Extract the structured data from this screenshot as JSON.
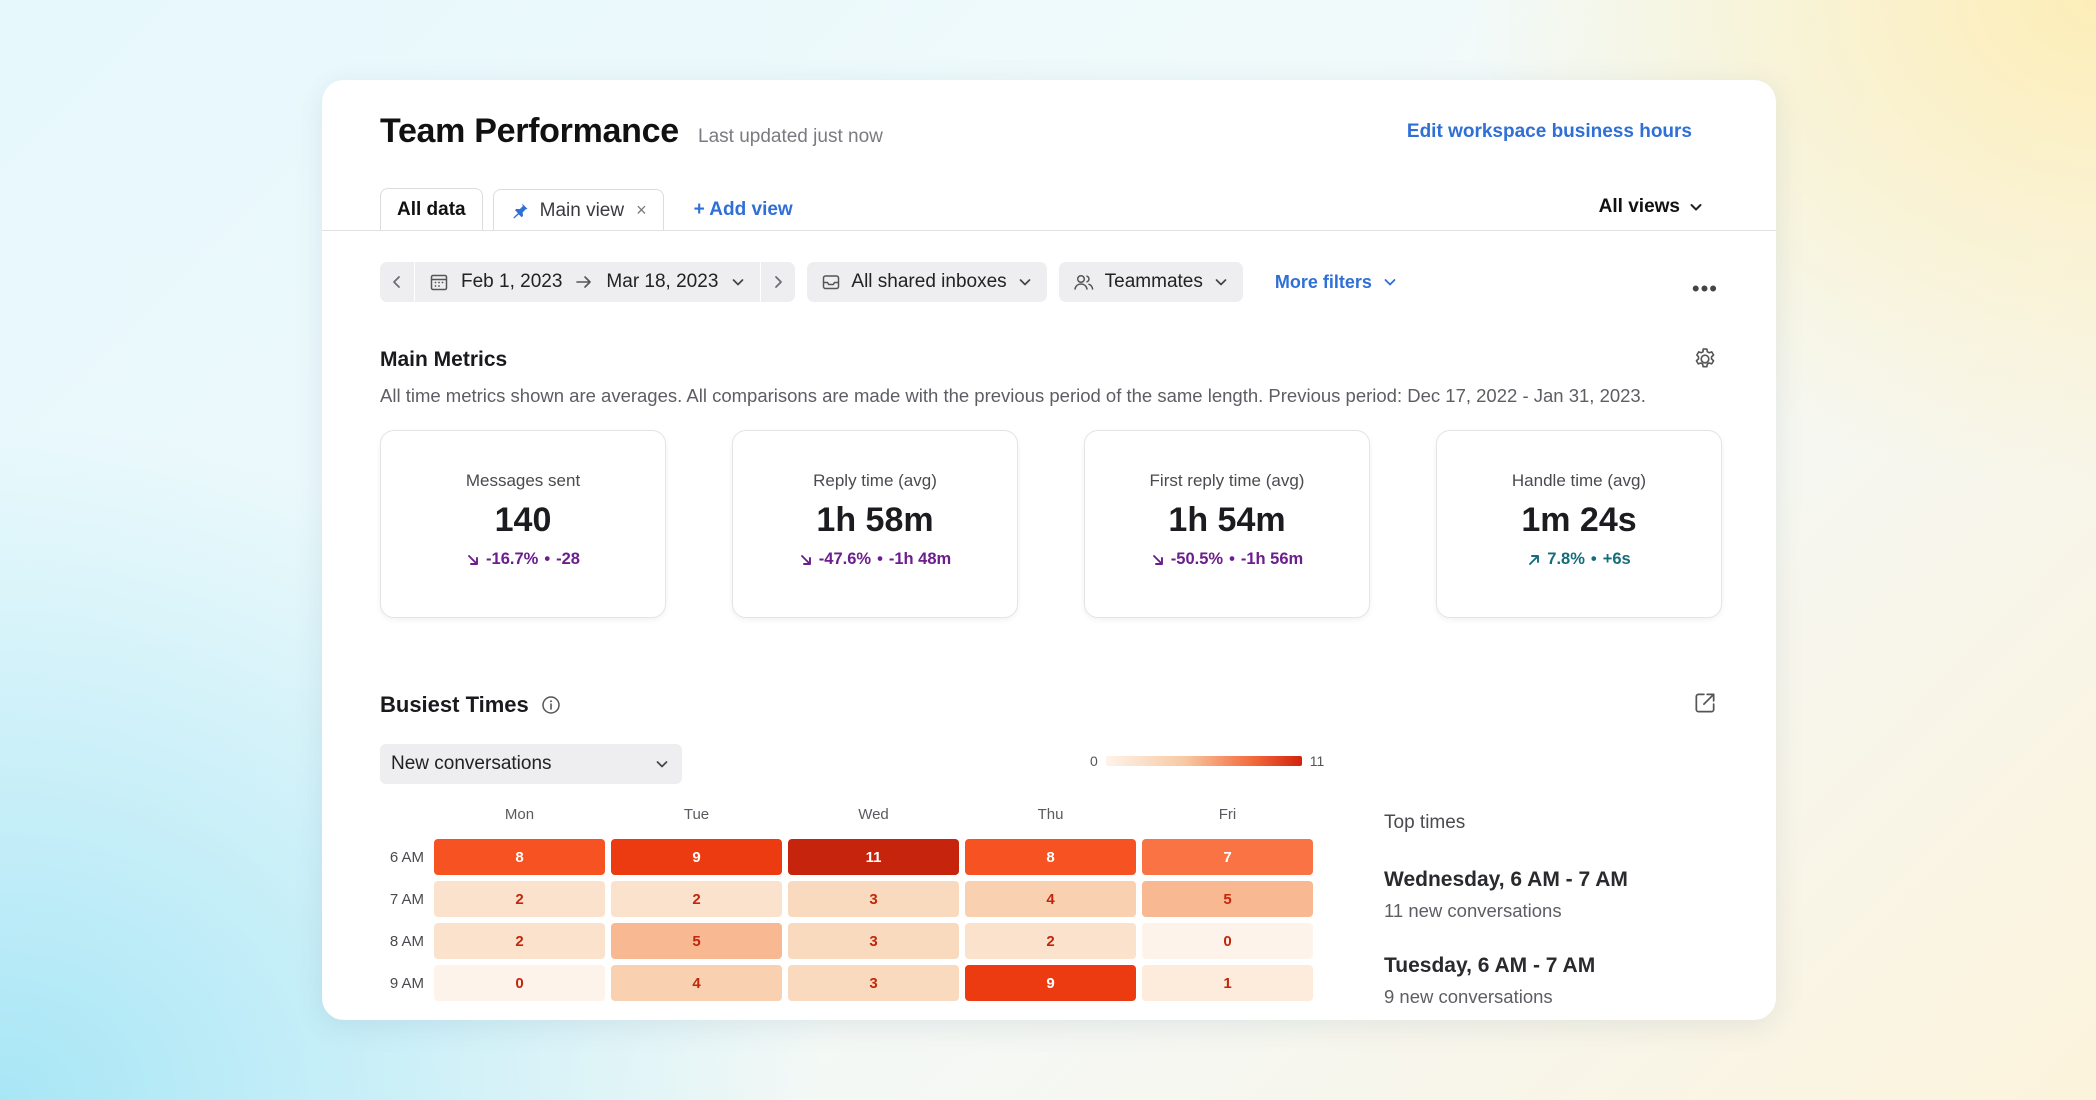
{
  "header": {
    "title": "Team Performance",
    "last_updated": "Last updated just now",
    "edit_hours_link": "Edit workspace business hours"
  },
  "tabs": [
    {
      "label": "All data",
      "active": true
    },
    {
      "label": "Main view",
      "pinned": true,
      "closable": true
    },
    {
      "label": "+ Add view",
      "action": true
    }
  ],
  "all_views_label": "All views",
  "filters": {
    "start_date": "Feb 1, 2023",
    "end_date": "Mar 18, 2023",
    "inbox": "All shared inboxes",
    "teammates": "Teammates",
    "more": "More filters"
  },
  "main_metrics": {
    "title": "Main Metrics",
    "description": "All time metrics shown are averages. All comparisons are made with the previous period of the same length. Previous period: Dec 17, 2022 - Jan 31, 2023.",
    "cards": [
      {
        "label": "Messages sent",
        "value": "140",
        "change": "-16.7%",
        "delta": "-28",
        "direction": "down"
      },
      {
        "label": "Reply time (avg)",
        "value": "1h 58m",
        "change": "-47.6%",
        "delta": "-1h 48m",
        "direction": "down"
      },
      {
        "label": "First reply time (avg)",
        "value": "1h 54m",
        "change": "-50.5%",
        "delta": "-1h 56m",
        "direction": "down"
      },
      {
        "label": "Handle time (avg)",
        "value": "1m 24s",
        "change": "7.8%",
        "delta": "+6s",
        "direction": "up"
      }
    ]
  },
  "busiest_times": {
    "title": "Busiest Times",
    "metric_select": "New conversations",
    "legend_min": "0",
    "legend_max": "11",
    "days": [
      "Mon",
      "Tue",
      "Wed",
      "Thu",
      "Fri"
    ],
    "hours": [
      "6 AM",
      "7 AM",
      "8 AM",
      "9 AM"
    ],
    "values": [
      [
        8,
        9,
        11,
        8,
        7
      ],
      [
        2,
        2,
        3,
        4,
        5
      ],
      [
        2,
        5,
        3,
        2,
        0
      ],
      [
        0,
        4,
        3,
        9,
        1
      ]
    ],
    "top_times": {
      "heading": "Top times",
      "items": [
        {
          "when": "Wednesday, 6 AM - 7 AM",
          "desc": "11 new conversations"
        },
        {
          "when": "Tuesday, 6 AM - 7 AM",
          "desc": "9 new conversations"
        }
      ]
    }
  },
  "colors": {
    "accent_link": "#2f6fd6",
    "trend_down": "#6b1e8c",
    "trend_up": "#156c7a",
    "heat_low": "#fef3ea",
    "heat_high": "#c9250c"
  }
}
